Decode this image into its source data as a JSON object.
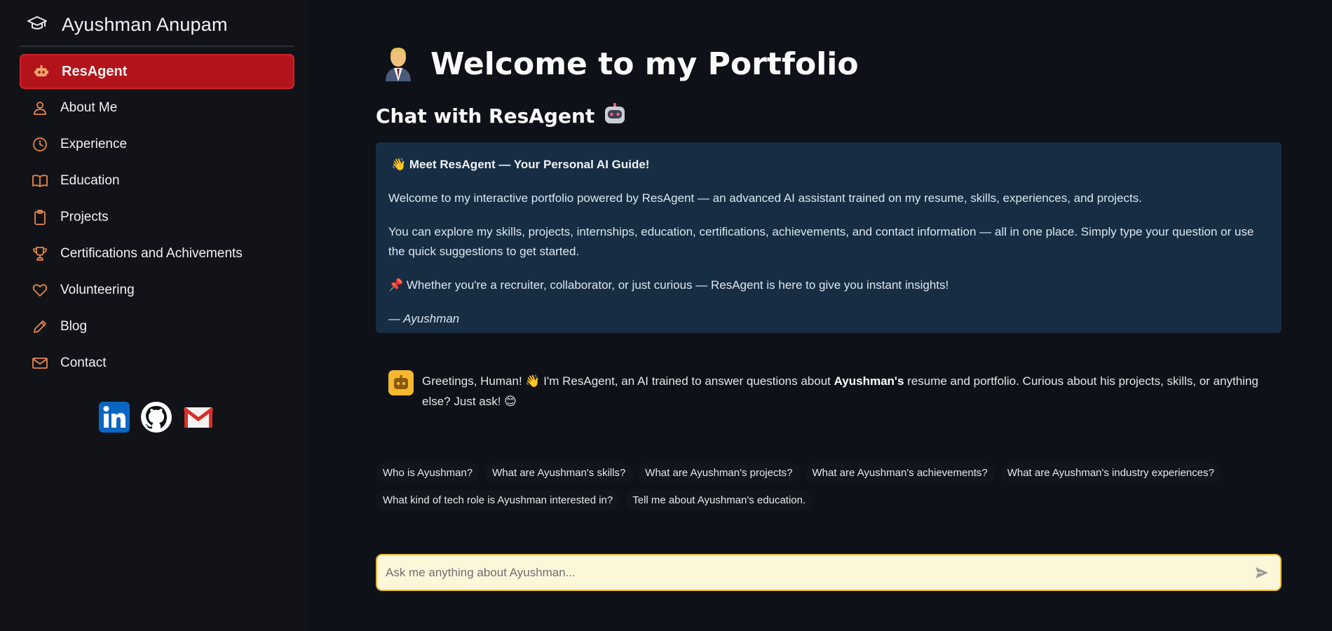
{
  "sidebar": {
    "brand_icon": "graduation-cap-icon",
    "brand_name": "Ayushman Anupam",
    "active_color": "#b3131a",
    "items": [
      {
        "label": "ResAgent",
        "icon": "robot-icon",
        "active": true
      },
      {
        "label": "About Me",
        "icon": "person-icon"
      },
      {
        "label": "Experience",
        "icon": "clock-icon"
      },
      {
        "label": "Education",
        "icon": "book-icon"
      },
      {
        "label": "Projects",
        "icon": "clipboard-icon"
      },
      {
        "label": "Certifications and Achivements",
        "icon": "trophy-icon"
      },
      {
        "label": "Volunteering",
        "icon": "heart-icon"
      },
      {
        "label": "Blog",
        "icon": "pencil-icon"
      },
      {
        "label": "Contact",
        "icon": "envelope-icon"
      }
    ],
    "socials": [
      {
        "name": "linkedin-icon"
      },
      {
        "name": "github-icon"
      },
      {
        "name": "gmail-icon"
      }
    ]
  },
  "main": {
    "title_icon": "person-in-suit-emoji",
    "title": "Welcome to my Portfolio",
    "subtitle": "Chat with ResAgent",
    "subtitle_icon": "robot-emoji",
    "intro": {
      "bg_color": "#172d43",
      "heading": "👋 Meet ResAgent — Your Personal AI Guide!",
      "p1": "Welcome to my interactive portfolio powered by ResAgent — an advanced AI assistant trained on my resume, skills, experiences, and projects.",
      "p2": "You can explore my skills, projects, internships, education, certifications, achievements, and contact information — all in one place. Simply type your question or use the quick suggestions to get started.",
      "p3": "📌 Whether you're a recruiter, collaborator, or just curious — ResAgent is here to give you instant insights!",
      "signature": "— Ayushman"
    },
    "chat": {
      "avatar_icon": "bot-avatar-icon",
      "msg_before": "Greetings, Human! 👋 I'm ResAgent, an AI trained to answer questions about ",
      "msg_bold": "Ayushman's",
      "msg_after": " resume and portfolio. Curious about his projects, skills, or anything else? Just ask! 😊"
    },
    "suggestions": [
      "Who is Ayushman?",
      "What are Ayushman's skills?",
      "What are Ayushman's projects?",
      "What are Ayushman's achievements?",
      "What are Ayushman's industry experiences?",
      "What kind of tech role is Ayushman interested in?",
      "Tell me about Ayushman's education."
    ],
    "input": {
      "placeholder": "Ask me anything about Ayushman...",
      "value": "",
      "send_icon": "send-arrow-icon",
      "border_color": "#e5b83b"
    }
  }
}
